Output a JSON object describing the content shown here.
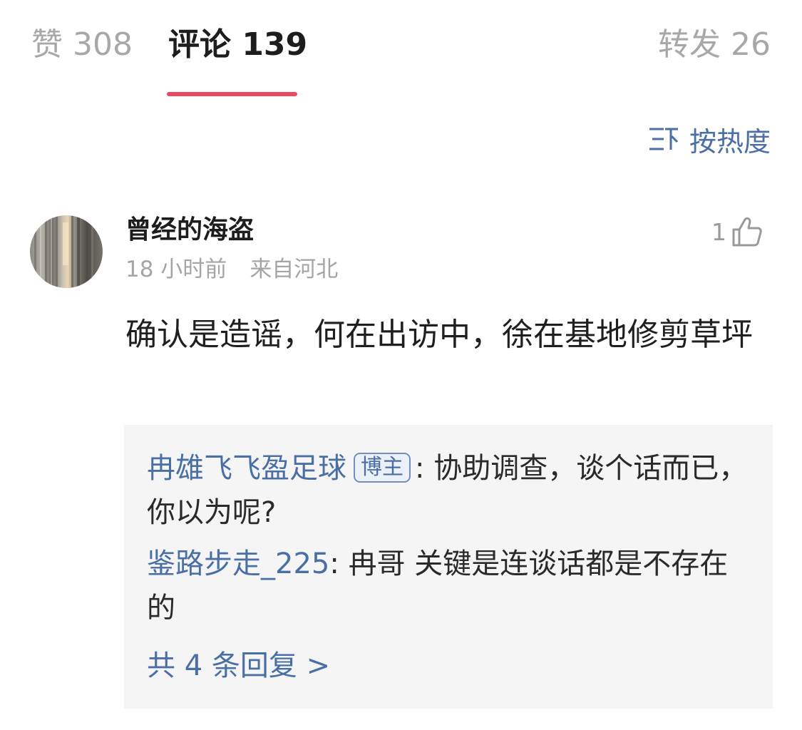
{
  "tabs": {
    "likes": "赞 308",
    "comments": "评论 139",
    "reposts": "转发 26"
  },
  "sort": {
    "label": "按热度",
    "icon": "sort-icon"
  },
  "comment": {
    "username": "曾经的海盗",
    "time": "18 小时前",
    "location": "来自河北",
    "like_count": "1",
    "text": "确认是造谣，何在出访中，徐在基地修剪草坪",
    "replies": [
      {
        "author": "冉雄飞飞盈足球",
        "badge": "博主",
        "separator": ": ",
        "text": "协助调查，谈个话而已，你以为呢?"
      },
      {
        "author": "鉴路步走_225",
        "separator": ": ",
        "text": "冉哥 关键是连谈话都是不存在的"
      }
    ],
    "view_replies": "共 4 条回复 >"
  },
  "colors": {
    "accent_underline": "#ea4b63",
    "link_blue": "#4a6fa5",
    "reply_bg": "#f5f5f5",
    "muted_text": "#a5a5a5"
  }
}
